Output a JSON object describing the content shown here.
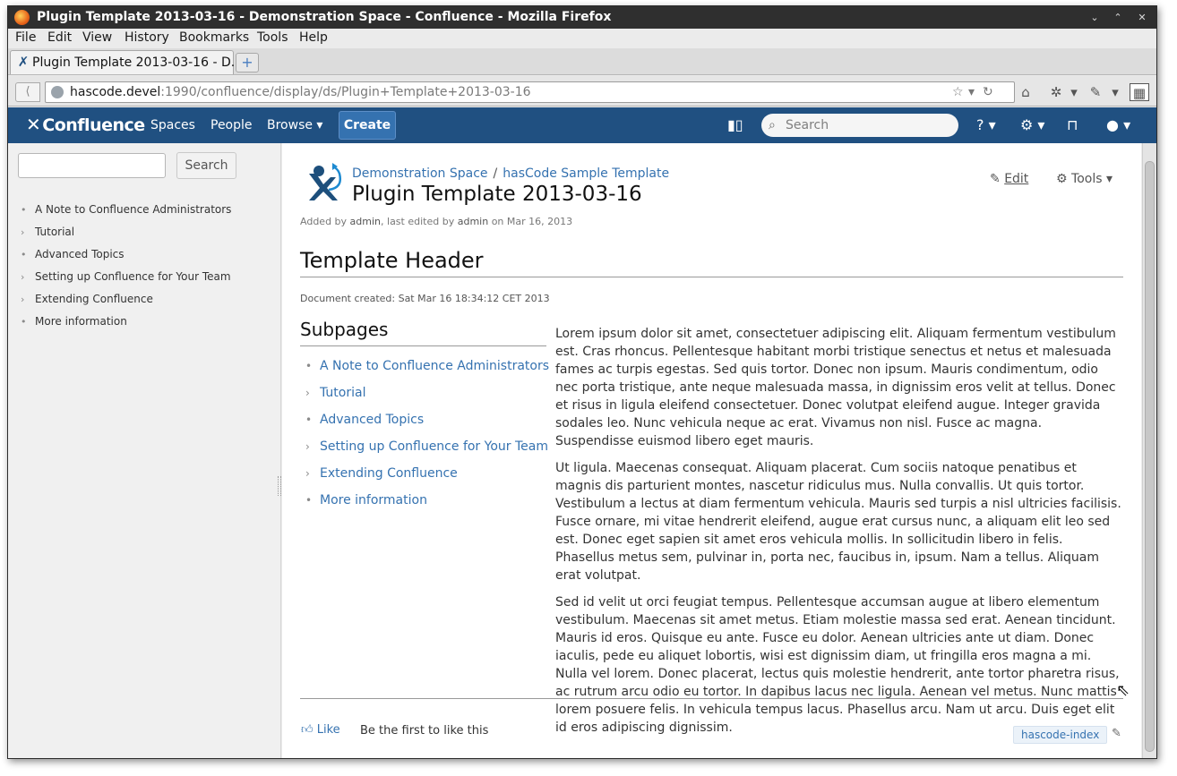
{
  "window": {
    "title": "Plugin Template 2013-03-16 - Demonstration Space - Confluence - Mozilla Firefox",
    "controls": [
      "⌄",
      "⌃",
      "✕"
    ]
  },
  "menu": [
    "File",
    "Edit",
    "View",
    "History",
    "Bookmarks",
    "Tools",
    "Help"
  ],
  "tab": {
    "label": "Plugin Template 2013-03-16 - D...",
    "new_tab": "+"
  },
  "url": {
    "host": "hascode.devel",
    "path": ":1990/confluence/display/ds/Plugin+Template+2013-03-16"
  },
  "header": {
    "logo": "Confluence",
    "nav": [
      "Spaces",
      "People",
      "Browse ▾"
    ],
    "create": "Create",
    "search_placeholder": "Search",
    "help_label": "? ▾",
    "settings_label": "⚙ ▾",
    "user_label": "▾"
  },
  "sidebar": {
    "search_button": "Search",
    "items": [
      {
        "bullet": "•",
        "label": "A Note to Confluence Administrators"
      },
      {
        "bullet": "›",
        "label": "Tutorial"
      },
      {
        "bullet": "•",
        "label": "Advanced Topics"
      },
      {
        "bullet": "›",
        "label": "Setting up Confluence for Your Team"
      },
      {
        "bullet": "›",
        "label": "Extending Confluence"
      },
      {
        "bullet": "•",
        "label": "More information"
      }
    ]
  },
  "page": {
    "breadcrumb": [
      "Demonstration Space",
      "hasCode Sample Template"
    ],
    "breadcrumb_sep": "/",
    "title": "Plugin Template 2013-03-16",
    "meta": {
      "added_by_prefix": "Added by",
      "author": "admin",
      "edited_prefix": ", last edited by",
      "editor": "admin",
      "date_prefix": "on",
      "date": "Mar 16, 2013"
    },
    "edit": "Edit",
    "tools": "Tools ▾"
  },
  "content": {
    "header": "Template Header",
    "created": "Document created: Sat Mar 16 18:34:12 CET 2013",
    "subpages_title": "Subpages",
    "subpages": [
      {
        "bullet": "•",
        "label": "A Note to Confluence Administrators"
      },
      {
        "bullet": "›",
        "label": "Tutorial"
      },
      {
        "bullet": "•",
        "label": "Advanced Topics"
      },
      {
        "bullet": "›",
        "label": "Setting up Confluence for Your Team"
      },
      {
        "bullet": "›",
        "label": "Extending Confluence"
      },
      {
        "bullet": "•",
        "label": "More information"
      }
    ],
    "paragraphs": [
      "Lorem ipsum dolor sit amet, consectetuer adipiscing elit. Aliquam fermentum vestibulum est. Cras rhoncus. Pellentesque habitant morbi tristique senectus et netus et malesuada fames ac turpis egestas. Sed quis tortor. Donec non ipsum. Mauris condimentum, odio nec porta tristique, ante neque malesuada massa, in dignissim eros velit at tellus. Donec et risus in ligula eleifend consectetuer. Donec volutpat eleifend augue. Integer gravida sodales leo. Nunc vehicula neque ac erat. Vivamus non nisl. Fusce ac magna. Suspendisse euismod libero eget mauris.",
      "Ut ligula. Maecenas consequat. Aliquam placerat. Cum sociis natoque penatibus et magnis dis parturient montes, nascetur ridiculus mus. Nulla convallis. Ut quis tortor. Vestibulum a lectus at diam fermentum vehicula. Mauris sed turpis a nisl ultricies facilisis. Fusce ornare, mi vitae hendrerit eleifend, augue erat cursus nunc, a aliquam elit leo sed est. Donec eget sapien sit amet eros vehicula mollis. In sollicitudin libero in felis. Phasellus metus sem, pulvinar in, porta nec, faucibus in, ipsum. Nam a tellus. Aliquam erat volutpat.",
      "Sed id velit ut orci feugiat tempus. Pellentesque accumsan augue at libero elementum vestibulum. Maecenas sit amet metus. Etiam molestie massa sed erat. Aenean tincidunt. Mauris id eros. Quisque eu ante. Fusce eu dolor. Aenean ultricies ante ut diam. Donec iaculis, pede eu aliquet lobortis, wisi est dignissim diam, ut fringilla eros magna a mi. Nulla vel lorem. Donec placerat, lectus quis molestie hendrerit, ante tortor pharetra risus, ac rutrum arcu odio eu tortor. In dapibus lacus nec ligula. Aenean vel metus. Nunc mattis lorem posuere felis. In vehicula tempus lacus. Phasellus arcu. Nam ut arcu. Duis eget elit id eros adipiscing dignissim."
    ],
    "like": "Like",
    "like_text": "Be the first to like this",
    "label": "hascode-index"
  },
  "colors": {
    "header_bg": "#205081",
    "create_bg": "#3572b0",
    "link": "#3572b0",
    "sidebar_bg": "#f0f0f0"
  },
  "icons": {
    "back": "back-arrow-icon",
    "globe": "globe-icon",
    "bookmark_star": "star-icon",
    "home": "home-icon",
    "addon": "puzzle-icon",
    "dropper": "eyedropper-icon",
    "grid": "grid-icon",
    "sidebar_toggle": "sidebar-toggle-icon",
    "search": "search-icon",
    "help": "help-icon",
    "settings": "gear-icon",
    "notifications": "inbox-icon",
    "user": "user-avatar-icon",
    "edit": "pencil-icon",
    "tools": "gear-icon",
    "like": "thumbs-up-icon",
    "label_edit": "pencil-icon",
    "space_logo": "space-logo-icon"
  }
}
